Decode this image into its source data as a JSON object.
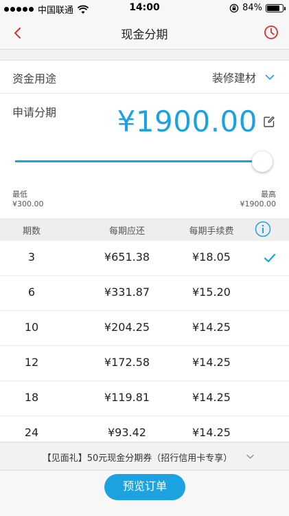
{
  "status_bar": {
    "carrier": "中国联通",
    "time": "14:00",
    "battery": "84%",
    "battery_level": 0.84
  },
  "nav": {
    "title": "现金分期",
    "back_icon": "back-chevron-icon",
    "history_icon": "clock-icon",
    "accent_color": "#e02e2e"
  },
  "purpose": {
    "label": "资金用途",
    "value": "装修建材"
  },
  "amount": {
    "label": "申请分期",
    "value": "¥1900.00",
    "accent_color": "#1aa3e0"
  },
  "slider": {
    "min": 300,
    "max": 1900,
    "current": 1900,
    "min_label": "最低",
    "min_value": "¥300.00",
    "max_label": "最高",
    "max_value": "¥1900.00"
  },
  "table": {
    "headers": [
      "期数",
      "每期应还",
      "每期手续费"
    ],
    "selected_index": 0,
    "rows": [
      {
        "periods": "3",
        "payment": "¥651.38",
        "fee": "¥18.05"
      },
      {
        "periods": "6",
        "payment": "¥331.87",
        "fee": "¥15.20"
      },
      {
        "periods": "10",
        "payment": "¥204.25",
        "fee": "¥14.25"
      },
      {
        "periods": "12",
        "payment": "¥172.58",
        "fee": "¥14.25"
      },
      {
        "periods": "18",
        "payment": "¥119.81",
        "fee": "¥14.25"
      },
      {
        "periods": "24",
        "payment": "¥93.42",
        "fee": "¥14.25"
      }
    ]
  },
  "coupon": {
    "text": "【见面礼】50元现金分期券（招行信用卡专享）"
  },
  "footer": {
    "preview_label": "预览订单"
  }
}
